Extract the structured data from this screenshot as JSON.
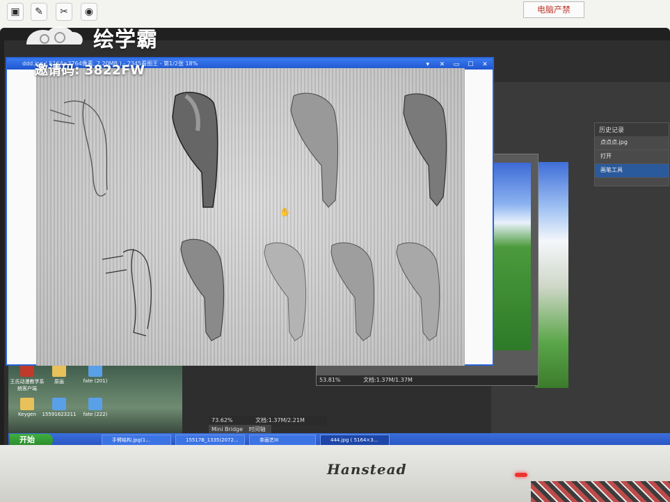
{
  "desk": {
    "label_sticker": "电脑产禁"
  },
  "watermark": {
    "brand_name": "绘学霸",
    "invite_code": "邀请码: 3822FW"
  },
  "viewer": {
    "title": "ddd.jpg ( 5164×3764像素, 2.20MB ) - 2345看图王 - 第1/2张 18%",
    "controls": [
      "▾",
      "✕",
      "▭",
      "☐",
      "✕"
    ]
  },
  "photoshop": {
    "history_panel_title": "历史记录",
    "history_items": [
      "点点点.jpg",
      "打开",
      "画笔工具"
    ],
    "doc_status": "53.81%",
    "doc_size": "文档:1.37M/1.37M",
    "main_status": "73.62%",
    "main_size": "文档:1.37M/2.21M",
    "bottom_tabs": [
      "Mini Bridge",
      "时间轴"
    ]
  },
  "desktop_icons": [
    {
      "label": "王氏动漫教学系统客户端"
    },
    {
      "label": "原画"
    },
    {
      "label": "fate (201)"
    },
    {
      "label": "Keygen"
    },
    {
      "label": "15591623211"
    },
    {
      "label": "fate (222)"
    }
  ],
  "taskbar": {
    "start_label": "开始",
    "tasks": [
      {
        "label": "手臂结构.jpg(1..."
      },
      {
        "label": "15517B_1335(2072..."
      },
      {
        "label": "茶画艺III"
      },
      {
        "label": "444.jpg ( 5164×3..."
      }
    ]
  },
  "monitor": {
    "brand": "Hanstead"
  },
  "colors": {
    "titlebar": "#2b63d9",
    "taskbar": "#2652bf",
    "start": "#2b8a2b",
    "sheet": "#cfcfcf"
  }
}
